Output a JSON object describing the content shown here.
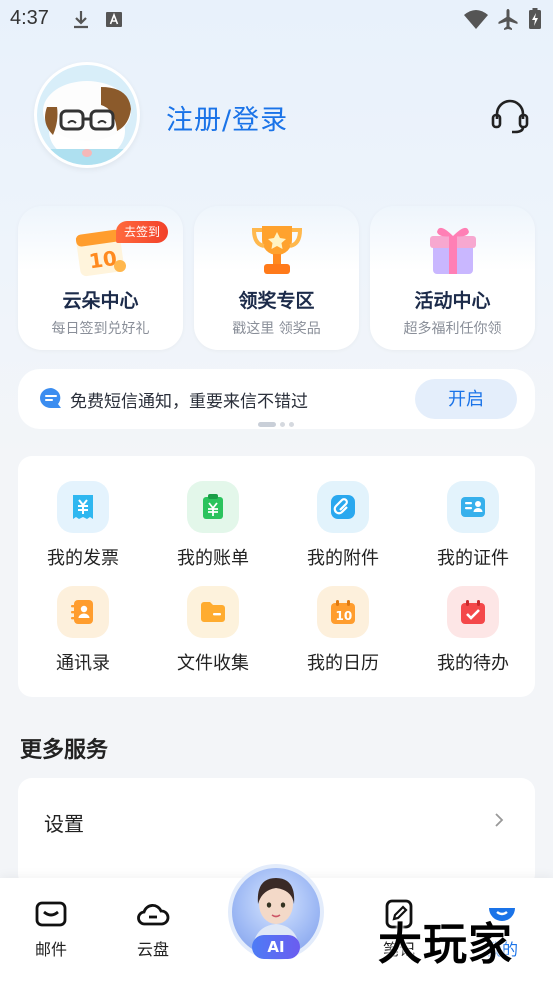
{
  "status_bar": {
    "time": "4:37",
    "icons": [
      "download-icon",
      "text-icon",
      "wifi-icon",
      "airplane-icon",
      "battery-icon"
    ]
  },
  "profile": {
    "login_label": "注册/登录",
    "support_icon": "headset-icon"
  },
  "feature_cards": [
    {
      "title": "云朵中心",
      "subtitle": "每日签到兑好礼",
      "badge": "去签到",
      "icon": "calendar-icon"
    },
    {
      "title": "领奖专区",
      "subtitle": "戳这里 领奖品",
      "icon": "trophy-icon"
    },
    {
      "title": "活动中心",
      "subtitle": "超多福利任你领",
      "icon": "gift-icon"
    }
  ],
  "notice": {
    "text": "免费短信通知，重要来信不错过",
    "button": "开启",
    "icon": "message-icon"
  },
  "grid": [
    {
      "label": "我的发票",
      "icon": "invoice-icon"
    },
    {
      "label": "我的账单",
      "icon": "bill-icon"
    },
    {
      "label": "我的附件",
      "icon": "attachment-icon"
    },
    {
      "label": "我的证件",
      "icon": "id-card-icon"
    },
    {
      "label": "通讯录",
      "icon": "contacts-icon"
    },
    {
      "label": "文件收集",
      "icon": "folder-icon"
    },
    {
      "label": "我的日历",
      "icon": "calendar-icon"
    },
    {
      "label": "我的待办",
      "icon": "todo-icon"
    }
  ],
  "more_services": {
    "title": "更多服务",
    "items": [
      {
        "label": "设置"
      }
    ]
  },
  "bottom_nav": {
    "items": [
      {
        "label": "邮件",
        "icon": "mail-icon"
      },
      {
        "label": "云盘",
        "icon": "cloud-icon"
      },
      {
        "label": "AI",
        "icon": "ai-assistant-icon"
      },
      {
        "label": "笔记",
        "icon": "note-icon"
      },
      {
        "label": "我的",
        "icon": "profile-icon"
      }
    ]
  },
  "watermark": "大玩家",
  "colors": {
    "accent": "#1a73e8",
    "badge": "#f2412a",
    "card_title": "#1c2b4a"
  }
}
